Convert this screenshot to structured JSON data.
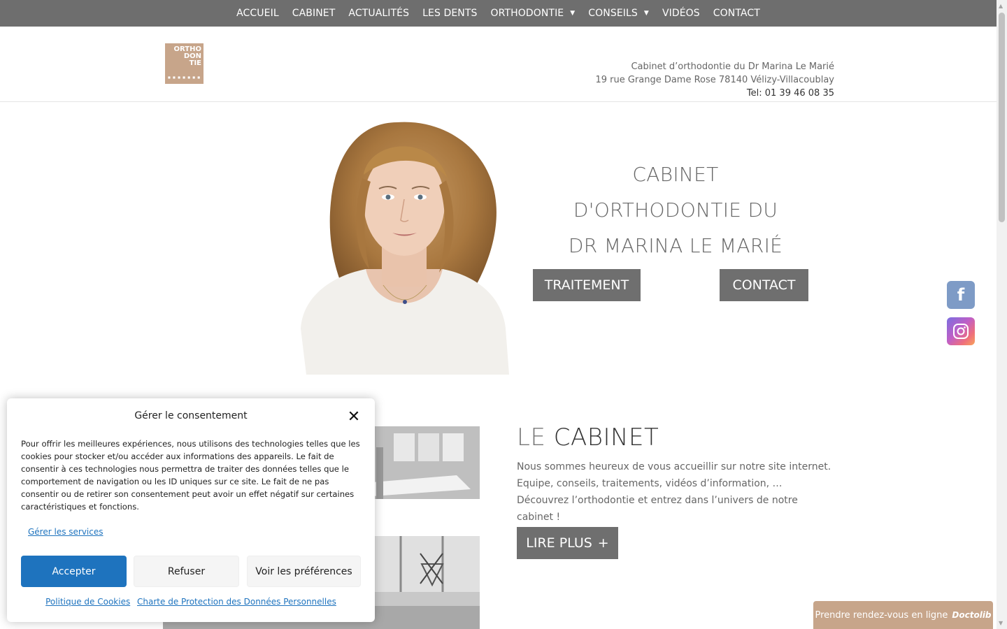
{
  "nav": {
    "items": [
      {
        "label": "ACCUEIL",
        "dropdown": false
      },
      {
        "label": "CABINET",
        "dropdown": false
      },
      {
        "label": "ACTUALITÉS",
        "dropdown": false
      },
      {
        "label": "LES DENTS",
        "dropdown": false
      },
      {
        "label": "ORTHODONTIE",
        "dropdown": true
      },
      {
        "label": "CONSEILS",
        "dropdown": true
      },
      {
        "label": "VIDÉOS",
        "dropdown": false
      },
      {
        "label": "CONTACT",
        "dropdown": false
      }
    ],
    "caret_icon": "chevron-down-icon"
  },
  "header": {
    "logo_lines": [
      "ORTHO",
      "DON",
      "TIE"
    ],
    "info_line1": "Cabinet d’orthodontie du Dr Marina Le Marié",
    "info_line2": "19 rue Grange Dame Rose 78140 Vélizy-Villacoublay",
    "tel": "Tel: 01 39 46 08 35"
  },
  "hero": {
    "title_lines": [
      "CABINET",
      "D'ORTHODONTIE DU",
      "DR MARINA LE MARIÉ"
    ],
    "btn_traitement": "TRAITEMENT",
    "btn_contact": "CONTACT"
  },
  "social": {
    "facebook_icon": "facebook-icon",
    "instagram_icon": "instagram-icon",
    "facebook_color": "#7e9bc6"
  },
  "cabinet": {
    "title_prefix": "LE",
    "title_main": "CABINET",
    "text": "Nous sommes heureux de vous accueillir sur notre site internet. Equipe, conseils, traitements, vidéos d’information, … Découvrez l’orthodontie et entrez dans l’univers de notre cabinet !",
    "btn_label": "LIRE PLUS",
    "btn_icon": "+"
  },
  "doctolib": {
    "label": "Prendre rendez-vous en ligne",
    "brand": "Doctolib",
    "color": "#c7a58a"
  },
  "cookie": {
    "title": "Gérer le consentement",
    "text": "Pour offrir les meilleures expériences, nous utilisons des technologies telles que les cookies pour stocker et/ou accéder aux informations des appareils. Le fait de consentir à ces technologies nous permettra de traiter des données telles que le comportement de navigation ou les ID uniques sur ce site. Le fait de ne pas consentir ou de retirer son consentement peut avoir un effet négatif sur certaines caractéristiques et fonctions.",
    "manage_link": "Gérer les services",
    "accept": "Accepter",
    "refuse": "Refuser",
    "prefs": "Voir les préférences",
    "policy_link": "Politique de Cookies",
    "charter_link": "Charte de Protection des Données Personnelles",
    "accent_color": "#1e73be"
  }
}
